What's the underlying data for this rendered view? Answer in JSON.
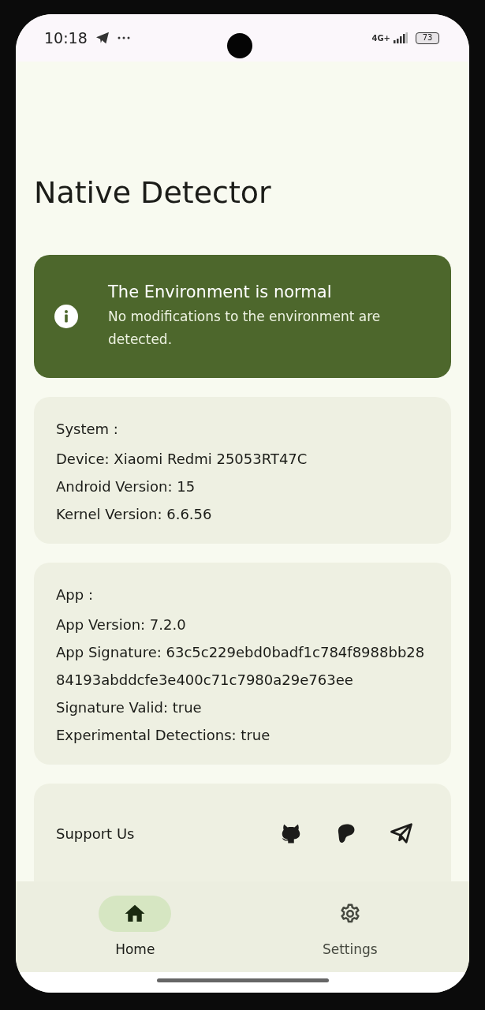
{
  "status_bar": {
    "time": "10:18",
    "network": "4G+",
    "battery": "73"
  },
  "title": "Native Detector",
  "banner": {
    "title": "The Environment is normal",
    "message": "No modifications to the environment are detected."
  },
  "cards": [
    {
      "heading": "System :",
      "lines": [
        "Device: Xiaomi Redmi 25053RT47C",
        "Android Version: 15",
        "Kernel Version: 6.6.56"
      ]
    },
    {
      "heading": "App :",
      "lines": [
        "App Version: 7.2.0",
        "App Signature: 63c5c229ebd0badf1c784f8988bb2884193abddcfe3e400c71c7980a29e763ee",
        "Signature Valid: true",
        "Experimental Detections: true"
      ]
    }
  ],
  "support": {
    "label": "Support Us"
  },
  "nav": [
    {
      "label": "Home",
      "kind": "home",
      "selected": true
    },
    {
      "label": "Settings",
      "kind": "settings",
      "selected": false
    }
  ]
}
